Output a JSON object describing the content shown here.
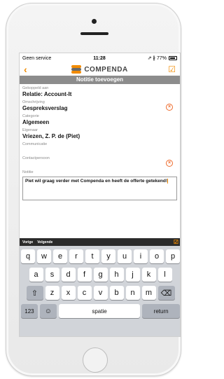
{
  "status_bar": {
    "carrier": "Geen service",
    "time": "11:28",
    "indicators": "⇗ ∦ 77%"
  },
  "nav": {
    "brand": "COMPENDA",
    "back_icon": "‹",
    "save_icon": "☑"
  },
  "title": "Notitie toevoegen",
  "fields": {
    "gekoppeld_label": "Gekoppeld aan",
    "gekoppeld_value": "Relatie: Account-It",
    "omschrijving_label": "Omschrijving",
    "omschrijving_value": "Gespreksverslag",
    "categorie_label": "Categorie",
    "categorie_value": "Algemeen",
    "eigenaar_label": "Eigenaar",
    "eigenaar_value": "Vriezen, Z. P. de  (Piet)",
    "communicatie_label": "Communicatie",
    "contactpersoon_label": "Contactpersoon",
    "notitie_label": "Notitie",
    "notitie_value": "Piet wil graag verder met Compenda en heeft de offerte getekend!"
  },
  "accessory": {
    "previous": "Vorige",
    "next": "Volgende"
  },
  "keyboard": {
    "row1": [
      "q",
      "w",
      "e",
      "r",
      "t",
      "y",
      "u",
      "i",
      "o",
      "p"
    ],
    "row2": [
      "a",
      "s",
      "d",
      "f",
      "g",
      "h",
      "j",
      "k",
      "l"
    ],
    "row3": [
      "z",
      "x",
      "c",
      "v",
      "b",
      "n",
      "m"
    ],
    "numbers_key": "123",
    "space_key": "spatie",
    "return_key": "return"
  },
  "colors": {
    "accent": "#f28b00",
    "title_bar": "#8c8c8c",
    "clear_icon": "#ee6b2c"
  }
}
